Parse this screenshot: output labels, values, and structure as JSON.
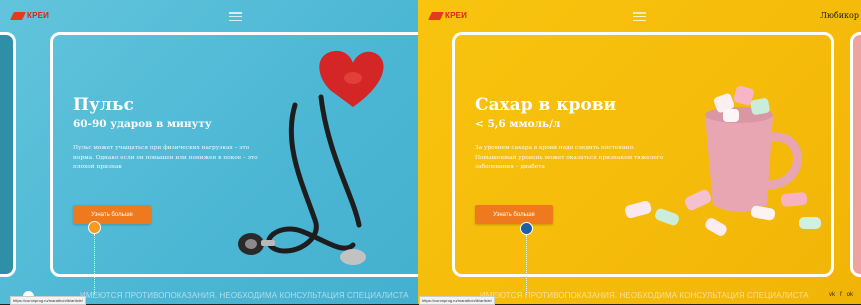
{
  "brand": {
    "logo_text": "КРЕИ"
  },
  "header": {
    "right_link": "Любикор"
  },
  "slides": [
    {
      "title": "Пульс",
      "subtitle": "60-90 ударов в минуту",
      "description": "Пульс может учащаться при физических нагрузках – это норма. Однако если он повышен или понижен в покое – это плохой признак",
      "button_label": "Узнать больше",
      "image": "stethoscope-heart",
      "accent": "#4cb7d4"
    },
    {
      "title": "Сахар в крови",
      "subtitle": "< 5,6 ммоль/л",
      "description": "За уровнем сахара в крови надо следить постоянно. Повышенный уровень может оказаться признаком тяжелого заболевания – диабета",
      "button_label": "Узнать больше",
      "image": "marshmallow-mug",
      "accent": "#f5bb0a"
    }
  ],
  "footer": {
    "disclaimer": "ИМЕЮТСЯ ПРОТИВОПОКАЗАНИЯ. НЕОБХОДИМА КОНСУЛЬТАЦИЯ СПЕЦИАЛИСТА",
    "status_url": "https://curonprog.ru/marathon/lb/article/"
  },
  "socials": [
    "vk",
    "f",
    "ok"
  ],
  "colors": {
    "button": "#ef7a1d",
    "cursor_blue": "#1c5fa8",
    "cursor_orange": "#f39c21"
  }
}
